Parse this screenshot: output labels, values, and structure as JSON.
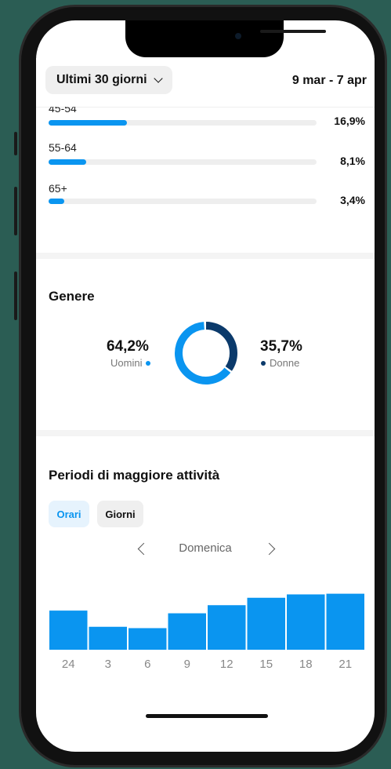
{
  "header": {
    "range_label": "Ultimi 30 giorni",
    "date_range": "9 mar - 7 apr"
  },
  "age": {
    "rows": [
      {
        "label": "45-54",
        "percent_text": "16,9%",
        "fill": 0.169
      },
      {
        "label": "55-64",
        "percent_text": "8,1%",
        "fill": 0.081
      },
      {
        "label": "65+",
        "percent_text": "3,4%",
        "fill": 0.034
      }
    ]
  },
  "gender": {
    "title": "Genere",
    "male": {
      "value": "64,2%",
      "label": "Uomini",
      "fraction": 0.642,
      "color": "#0a95f0"
    },
    "female": {
      "value": "35,7%",
      "label": "Donne",
      "fraction": 0.357,
      "color": "#0b3a6b"
    }
  },
  "activity": {
    "title": "Periodi di maggiore attività",
    "tabs": [
      {
        "label": "Orari",
        "selected": true
      },
      {
        "label": "Giorni",
        "selected": false
      }
    ],
    "day": "Domenica",
    "bar_color": "#0a95f0"
  },
  "chart_data": {
    "type": "bar",
    "categories": [
      "24",
      "3",
      "6",
      "9",
      "12",
      "15",
      "18",
      "21"
    ],
    "values": [
      58,
      34,
      32,
      54,
      66,
      77,
      82,
      83
    ],
    "ylim": [
      0,
      100
    ],
    "grid": false
  }
}
